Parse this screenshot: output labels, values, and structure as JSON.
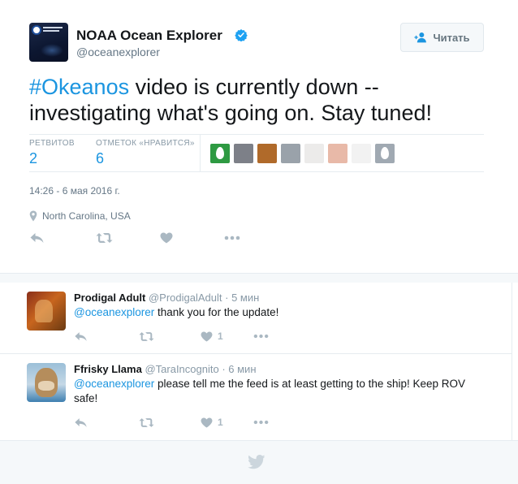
{
  "author": {
    "name": "NOAA Ocean Explorer",
    "handle": "@oceanexplorer",
    "avatar_icon": "noaa-logo-icon",
    "verified_icon": "verified-badge-icon"
  },
  "follow_button": {
    "label": "Читать",
    "icon": "follow-user-icon"
  },
  "tweet": {
    "hashtag": "#Okeanos",
    "text": " video is currently down -- investigating what's going on. Stay tuned!",
    "timestamp": "14:26 - 6 мая 2016 г.",
    "location": "North Carolina, USA"
  },
  "stats": {
    "retweets_label": "РЕТВИТОВ",
    "retweets_value": "2",
    "likes_label": "ОТМЕТОК «НРАВИТСЯ»",
    "likes_value": "6"
  },
  "likers": [
    {
      "name": "liker-avatar-1",
      "color": "#2e9a42",
      "egg": true
    },
    {
      "name": "liker-avatar-2",
      "color": "#7d8088",
      "egg": false
    },
    {
      "name": "liker-avatar-3",
      "color": "#b06a2a",
      "egg": false
    },
    {
      "name": "liker-avatar-4",
      "color": "#9aa2aa",
      "egg": false
    },
    {
      "name": "liker-avatar-5",
      "color": "#ecebea",
      "egg": false
    },
    {
      "name": "liker-avatar-6",
      "color": "#e8b9a8",
      "egg": false
    },
    {
      "name": "liker-avatar-7",
      "color": "#f2f2f2",
      "egg": false
    },
    {
      "name": "liker-avatar-8",
      "color": "#a0a9b2",
      "egg": true
    }
  ],
  "replies": [
    {
      "name": "Prodigal Adult",
      "handle": "@ProdigalAdult",
      "time": "5 мин",
      "mention": "@oceanexplorer",
      "text": " thank you for the update!",
      "like_count": "1"
    },
    {
      "name": "Ffrisky Llama",
      "handle": "@TaraIncognito",
      "time": "6 мин",
      "mention": "@oceanexplorer",
      "text": " please tell me the feed is at least getting to the ship! Keep ROV safe!",
      "like_count": "1"
    }
  ],
  "colors": {
    "link": "#1b95e0",
    "muted": "#657786",
    "icon": "#aab8c2",
    "border": "#e6ecf0"
  }
}
